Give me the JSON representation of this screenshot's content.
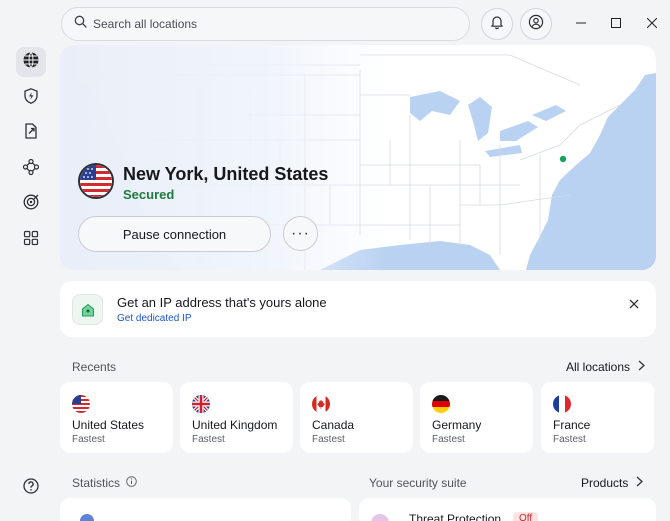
{
  "search": {
    "placeholder": "Search all locations"
  },
  "connection": {
    "location": "New York, United States",
    "status": "Secured",
    "pause_label": "Pause connection",
    "more_label": "···"
  },
  "promo": {
    "title": "Get an IP address that's yours alone",
    "link": "Get dedicated IP"
  },
  "recents": {
    "label": "Recents",
    "all_label": "All locations",
    "items": [
      {
        "country": "United States",
        "speed": "Fastest",
        "flag": "us-flag"
      },
      {
        "country": "United Kingdom",
        "speed": "Fastest",
        "flag": "uk-flag"
      },
      {
        "country": "Canada",
        "speed": "Fastest",
        "flag": "ca-flag"
      },
      {
        "country": "Germany",
        "speed": "Fastest",
        "flag": "de-flag"
      },
      {
        "country": "France",
        "speed": "Fastest",
        "flag": "fr-flag"
      }
    ]
  },
  "statistics": {
    "label": "Statistics"
  },
  "suite": {
    "label": "Your security suite",
    "products_label": "Products",
    "threat_label": "Threat Protection",
    "threat_status": "Off"
  },
  "colors": {
    "accent_green": "#1f7a3f",
    "link_blue": "#1b55c9",
    "map_land": "#ffffff",
    "map_water": "#b7d1f2"
  },
  "icons": [
    "search-icon",
    "bell-icon",
    "account-icon",
    "minimize-icon",
    "maximize-icon",
    "close-icon",
    "globe-icon",
    "shield-icon",
    "file-scan-icon",
    "mesh-icon",
    "threat-eye-icon",
    "apps-icon",
    "help-icon",
    "info-icon",
    "chevron-right-icon",
    "home-ip-icon"
  ]
}
